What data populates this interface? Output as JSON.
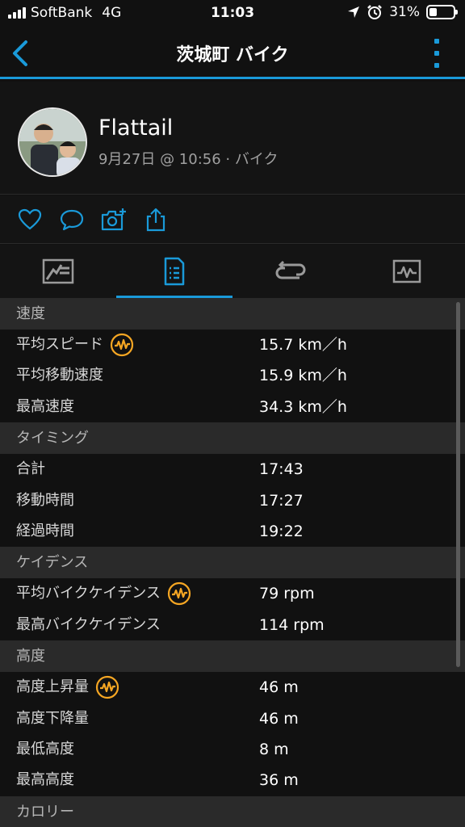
{
  "status_bar": {
    "carrier": "SoftBank",
    "network": "4G",
    "time": "11:03",
    "battery_percent": "31%",
    "battery_level": 0.31
  },
  "nav": {
    "title": "茨城町 バイク",
    "accent_color": "#1a9ad9"
  },
  "profile": {
    "name": "Flattail",
    "meta": "9月27日 @ 10:56 · バイク"
  },
  "actions": {
    "icons": [
      "heart-icon",
      "comment-icon",
      "camera-add-icon",
      "share-icon"
    ]
  },
  "tabs": {
    "icons": [
      "overview-map-icon",
      "stats-list-icon",
      "laps-icon",
      "chart-icon"
    ],
    "active_index": 1
  },
  "stats": {
    "badge_color": "#f5a623",
    "sections": [
      {
        "title": "速度",
        "rows": [
          {
            "label": "平均スピード",
            "value": "15.7 km／h",
            "badge": true
          },
          {
            "label": "平均移動速度",
            "value": "15.9 km／h",
            "badge": false
          },
          {
            "label": "最高速度",
            "value": "34.3 km／h",
            "badge": false
          }
        ]
      },
      {
        "title": "タイミング",
        "rows": [
          {
            "label": "合計",
            "value": "17:43",
            "badge": false
          },
          {
            "label": "移動時間",
            "value": "17:27",
            "badge": false
          },
          {
            "label": "経過時間",
            "value": "19:22",
            "badge": false
          }
        ]
      },
      {
        "title": "ケイデンス",
        "rows": [
          {
            "label": "平均バイクケイデンス",
            "value": "79 rpm",
            "badge": true
          },
          {
            "label": "最高バイクケイデンス",
            "value": "114 rpm",
            "badge": false
          }
        ]
      },
      {
        "title": "高度",
        "rows": [
          {
            "label": "高度上昇量",
            "value": "46 m",
            "badge": true
          },
          {
            "label": "高度下降量",
            "value": "46 m",
            "badge": false
          },
          {
            "label": "最低高度",
            "value": "8 m",
            "badge": false
          },
          {
            "label": "最高高度",
            "value": "36 m",
            "badge": false
          }
        ]
      },
      {
        "title": "カロリー",
        "rows": []
      }
    ]
  }
}
